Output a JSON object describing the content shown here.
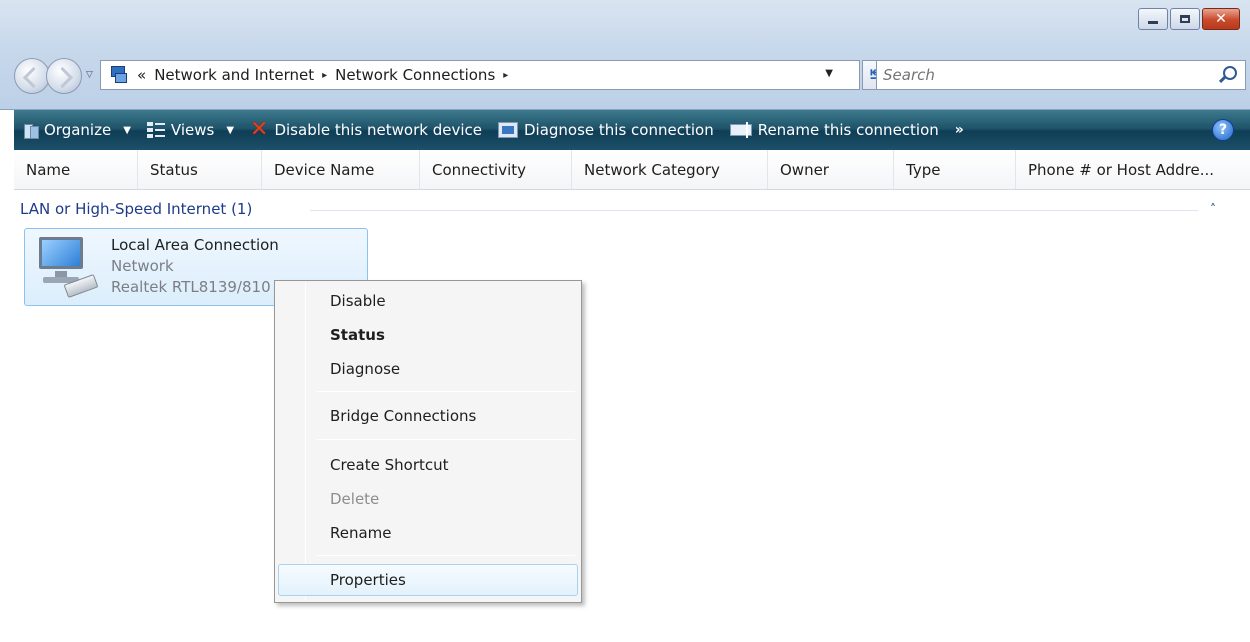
{
  "window": {
    "minimize_icon": "minimize-icon",
    "maximize_icon": "maximize-icon",
    "close_icon": "close-icon"
  },
  "navigation": {
    "breadcrumb_prefix": "«",
    "breadcrumbs": [
      "Network and Internet",
      "Network Connections"
    ],
    "breadcrumb_separator": "▸",
    "search_placeholder": "Search"
  },
  "toolbar": {
    "organize": "Organize",
    "views": "Views",
    "disable_device": "Disable this network device",
    "diagnose": "Diagnose this connection",
    "rename": "Rename this connection",
    "more": "»",
    "help": "?"
  },
  "columns": [
    "Name",
    "Status",
    "Device Name",
    "Connectivity",
    "Network Category",
    "Owner",
    "Type",
    "Phone # or Host Addre..."
  ],
  "group": {
    "label": "LAN or High-Speed Internet (1)",
    "toggle": "˄"
  },
  "connection": {
    "name": "Local Area Connection",
    "status": "Network",
    "device": "Realtek RTL8139/810"
  },
  "context_menu": {
    "items": [
      "Disable",
      "Status",
      "Diagnose",
      "Bridge Connections",
      "Create Shortcut",
      "Delete",
      "Rename",
      "Properties"
    ],
    "default_item": "Status",
    "disabled_item": "Delete",
    "hover_item": "Properties"
  },
  "colors": {
    "command_bar": "#1d5168",
    "group_header": "#1e3b8a",
    "selection": "#dbeefc",
    "menu_background": "#f5f5f5"
  }
}
